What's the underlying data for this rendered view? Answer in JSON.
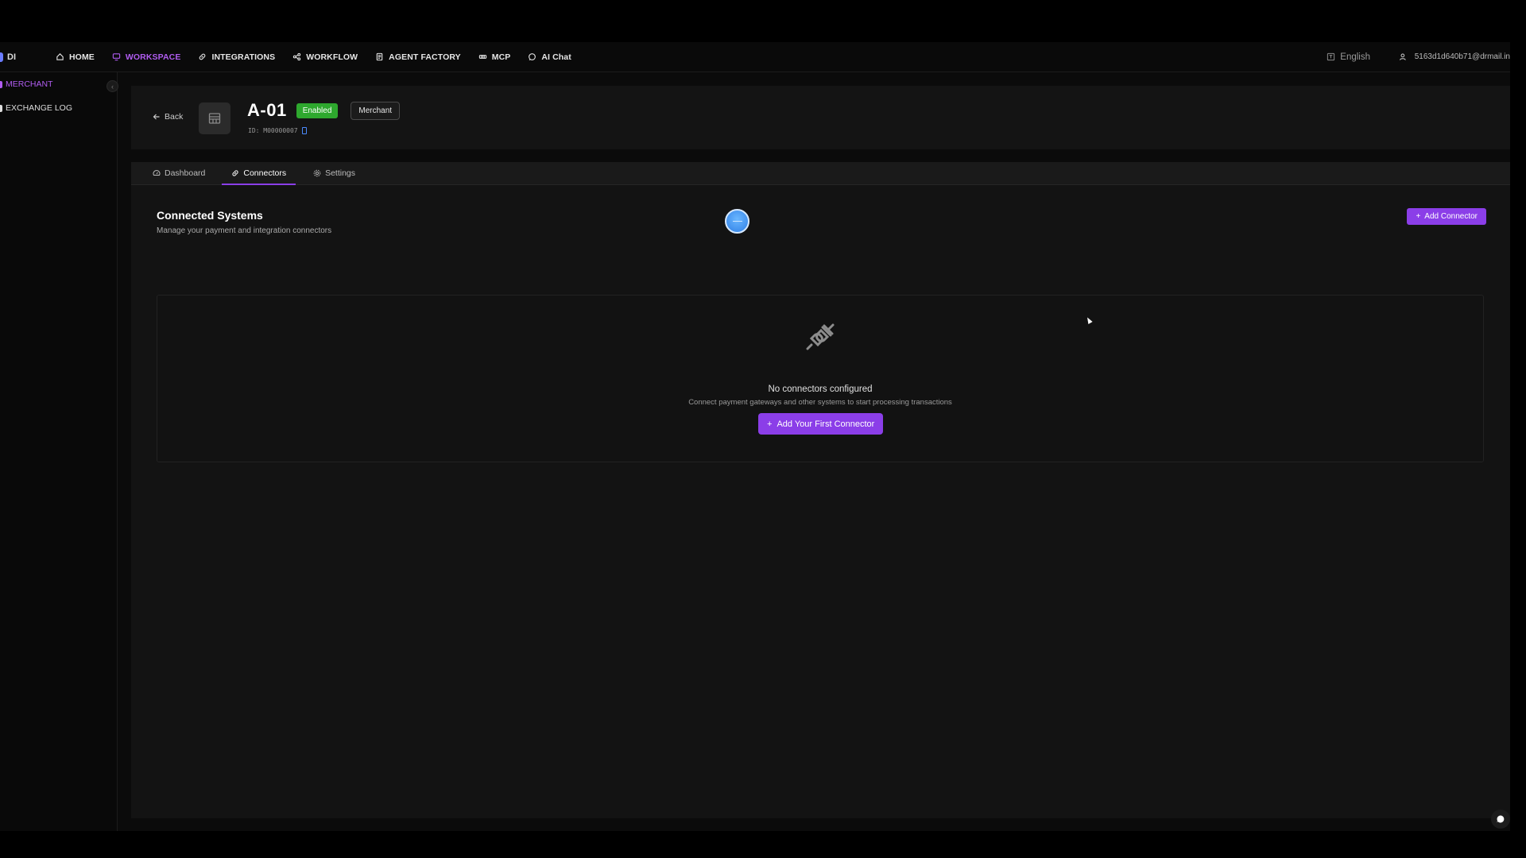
{
  "nav": {
    "brand": "DI",
    "items": [
      {
        "label": "HOME",
        "icon": "home-icon"
      },
      {
        "label": "WORKSPACE",
        "icon": "monitor-icon",
        "active": true
      },
      {
        "label": "INTEGRATIONS",
        "icon": "link-icon"
      },
      {
        "label": "WORKFLOW",
        "icon": "share-icon"
      },
      {
        "label": "AGENT FACTORY",
        "icon": "document-icon"
      },
      {
        "label": "MCP",
        "icon": "plug-icon"
      },
      {
        "label": "AI Chat",
        "icon": "chat-icon"
      }
    ],
    "language": "English",
    "user_email": "5163d1d640b71@drmail.in"
  },
  "sidebar": {
    "items": [
      {
        "label": "MERCHANT",
        "active": true
      },
      {
        "label": "EXCHANGE LOG",
        "active": false
      }
    ]
  },
  "header": {
    "back_label": "Back",
    "title": "A-01",
    "status": "Enabled",
    "type": "Merchant",
    "id_text": "ID: M00000007"
  },
  "tabs": [
    {
      "label": "Dashboard",
      "icon": "gauge-icon"
    },
    {
      "label": "Connectors",
      "icon": "link-icon",
      "active": true
    },
    {
      "label": "Settings",
      "icon": "gear-icon"
    }
  ],
  "section": {
    "title": "Connected Systems",
    "subtitle": "Manage your payment and integration connectors",
    "add_button": "Add Connector"
  },
  "empty_state": {
    "title": "No connectors configured",
    "subtitle": "Connect payment gateways and other systems to start processing transactions",
    "button": "Add Your First Connector"
  },
  "colors": {
    "accent": "#8b3ee8",
    "active_nav": "#b05cf0",
    "enabled": "#2ea82e"
  }
}
